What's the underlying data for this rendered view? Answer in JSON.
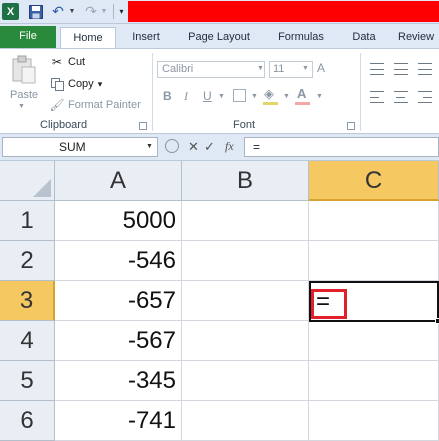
{
  "qat": {
    "app_icon": "excel-icon",
    "icons": [
      "save-icon",
      "undo-icon",
      "redo-icon",
      "customize-qat-icon"
    ],
    "logo_text": "X"
  },
  "tabs": {
    "file": "File",
    "home": "Home",
    "insert": "Insert",
    "page_layout": "Page Layout",
    "formulas": "Formulas",
    "data": "Data",
    "review": "Review"
  },
  "clipboard": {
    "paste": "Paste",
    "cut": "Cut",
    "copy": "Copy",
    "copy_dd": "▾",
    "format_painter": "Format Painter",
    "group_label": "Clipboard"
  },
  "font": {
    "font_name": "Calibri",
    "font_size": "11",
    "bold": "B",
    "italic": "I",
    "underline": "U",
    "group_label": "Font"
  },
  "formula_bar": {
    "name_box": "SUM",
    "cancel": "✕",
    "enter": "✓",
    "fx": "fx",
    "content": "="
  },
  "grid": {
    "columns": [
      "A",
      "B",
      "C"
    ],
    "selected_column": "C",
    "rows": [
      "1",
      "2",
      "3",
      "4",
      "5",
      "6"
    ],
    "selected_row": "3",
    "column_a_values": [
      "5000",
      "-546",
      "-657",
      "-567",
      "-345",
      "-741"
    ],
    "active_cell": "C3",
    "active_cell_edit": "="
  },
  "colors": {
    "file_tab": "#2a8a3b",
    "selected_header": "#f5c862",
    "highlight": "#e0202a",
    "title_band": "#ff0000"
  }
}
